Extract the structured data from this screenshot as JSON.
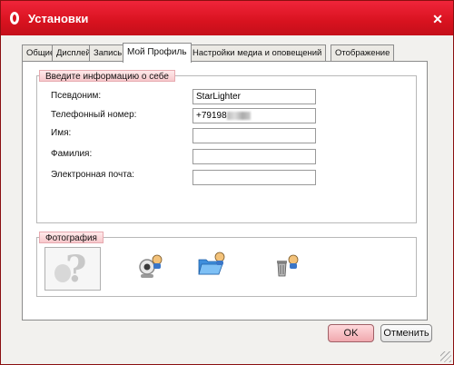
{
  "window": {
    "title": "Установки",
    "close_glyph": "✕"
  },
  "tabs": [
    {
      "label": "Общие"
    },
    {
      "label": "Дисплей"
    },
    {
      "label": "Запись"
    },
    {
      "label": "Мой Профиль",
      "active": true
    },
    {
      "label": "Настройки медиа и оповещений"
    },
    {
      "label": "Отображение"
    }
  ],
  "profile": {
    "group_title": "Введите информацию о себе",
    "fields": [
      {
        "label": "Псевдоним:",
        "value": "StarLighter"
      },
      {
        "label": "Телефонный номер:",
        "value": "+79198",
        "value_suffix": "[blurred]"
      },
      {
        "label": "Имя:",
        "value": ""
      },
      {
        "label": "Фамилия:",
        "value": ""
      },
      {
        "label": "Электронная почта:",
        "value": ""
      }
    ]
  },
  "photo": {
    "group_title": "Фотография",
    "icons": [
      "avatar-placeholder-icon",
      "webcam-icon",
      "open-folder-icon",
      "trash-icon"
    ]
  },
  "buttons": {
    "ok": "OK",
    "cancel": "Отменить"
  },
  "colors": {
    "titlebar": "#d8121f",
    "accent_pink": "#f7c8cc"
  }
}
